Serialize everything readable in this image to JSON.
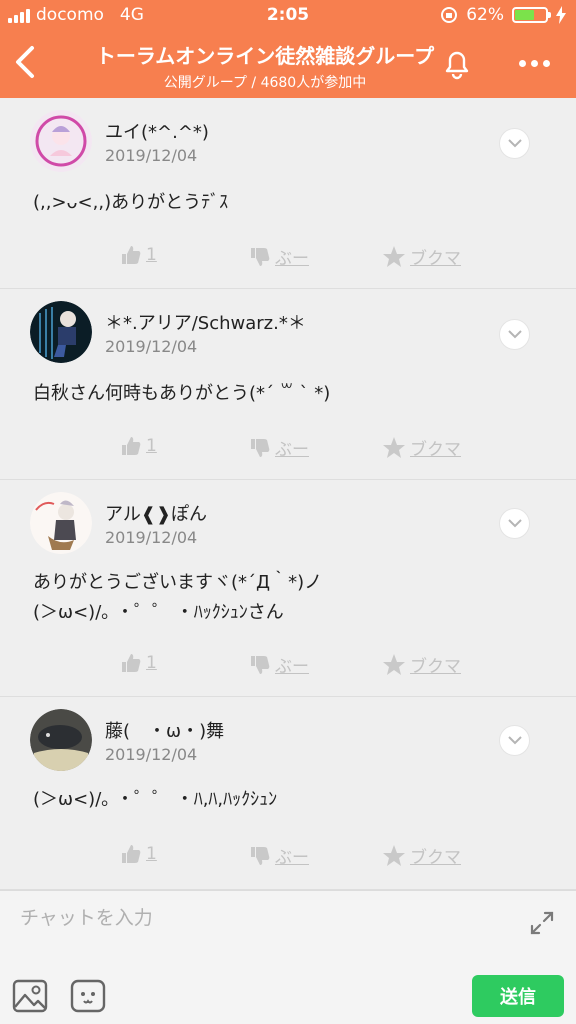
{
  "status_bar": {
    "carrier": "docomo",
    "network": "4G",
    "time": "2:05",
    "battery_percent": "62%",
    "battery_level": 0.62
  },
  "header": {
    "title": "トーラムオンライン徒然雑談グループ",
    "subtitle": "公開グループ / 4680人が参加中"
  },
  "colors": {
    "header_bg": "#f77f4f",
    "send_button": "#2ecb60",
    "battery_fill": "#7be24b"
  },
  "posts": [
    {
      "user": "ユイ(*^.^*)",
      "date": "2019/12/04",
      "text": [
        "(,,>ᴗ<,,)ありがとうﾃﾞｽ"
      ],
      "likes": "1",
      "boo": "ぶー",
      "bookmark": "ブクマ"
    },
    {
      "user": "＊*.アリア/Schwarz.*＊",
      "date": "2019/12/04",
      "text": [
        "白秋さん何時もありがとう(*´ ꒳ ` *)"
      ],
      "likes": "1",
      "boo": "ぶー",
      "bookmark": "ブクマ"
    },
    {
      "user": "アル❰❱ぽん",
      "date": "2019/12/04",
      "text": [
        "ありがとうございますヾ(*´Д｀*)ノ",
        "(＞ω<)/｡ ・゜゜ ・ﾊｯｸｼｭﾝさん"
      ],
      "likes": "1",
      "boo": "ぶー",
      "bookmark": "ブクマ"
    },
    {
      "user": "藤(　・ω・)舞",
      "date": "2019/12/04",
      "text": [
        "(＞ω<)/｡ ・゜゜ ・ﾊ,ﾊ,ﾊｯｸｼｭﾝ"
      ],
      "likes": "1",
      "boo": "ぶー",
      "bookmark": "ブクマ"
    }
  ],
  "composer": {
    "placeholder": "チャットを入力",
    "send_label": "送信"
  },
  "icons": [
    "back-icon",
    "bell-icon",
    "more-icon",
    "chevron-down-icon",
    "thumbs-up-icon",
    "thumbs-down-icon",
    "star-icon",
    "expand-icon",
    "image-icon",
    "sticker-icon"
  ]
}
